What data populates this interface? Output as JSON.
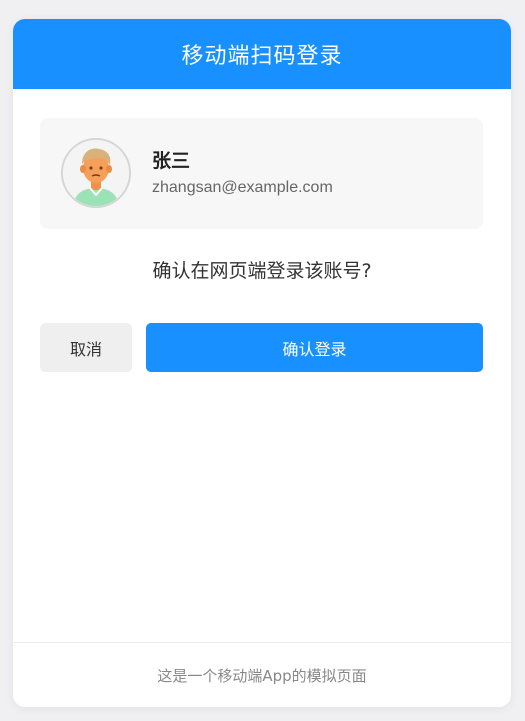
{
  "header": {
    "title": "移动端扫码登录"
  },
  "user": {
    "name": "张三",
    "email": "zhangsan@example.com",
    "avatar_icon": "user-avatar-icon"
  },
  "prompt": {
    "question": "确认在网页端登录该账号?"
  },
  "actions": {
    "cancel_label": "取消",
    "confirm_label": "确认登录"
  },
  "footer": {
    "note": "这是一个移动端App的模拟页面"
  },
  "colors": {
    "accent": "#1890ff",
    "page_background": "#f0f0f3",
    "card_background": "#ffffff",
    "user_box_background": "#f7f7f7",
    "cancel_button_background": "#efefef"
  }
}
